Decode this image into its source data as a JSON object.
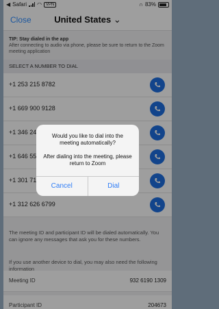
{
  "status_bar": {
    "carrier": "Safari",
    "vpn": "VPN",
    "battery": "83%"
  },
  "nav": {
    "close": "Close",
    "title": "United States"
  },
  "tip": {
    "label": "TIP: Stay dialed in the app",
    "text": "After connecting to audio via phone, please be sure to return to the Zoom meeting application"
  },
  "section": "SELECT A NUMBER TO DIAL",
  "numbers": [
    "+1 253 215 8782",
    "+1 669 900 9128",
    "+1 346 248 7799",
    "+1 646 558 8656",
    "+1 301 715 8592",
    "+1 312 626 6799"
  ],
  "note": "The meeting ID and participant ID will be dialed automatically. You can ignore any messages that ask you for these numbers.",
  "note2": "If you use another device to dial, you may also need the following information",
  "meeting": {
    "label": "Meeting ID",
    "value": "932 6190 1309"
  },
  "participant": {
    "label": "Participant ID",
    "value": "204673"
  },
  "dialog": {
    "title": "Would you like to dial into the meeting automatically?",
    "message": "After dialing into the meeting, please return to Zoom",
    "cancel": "Cancel",
    "dial": "Dial"
  }
}
